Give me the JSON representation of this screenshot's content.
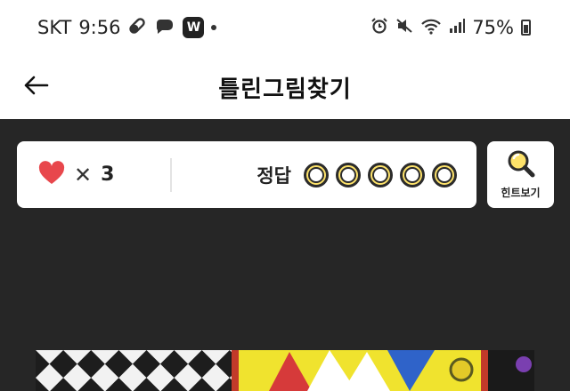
{
  "status_bar": {
    "carrier": "SKT",
    "time": "9:56",
    "battery_percent": "75%",
    "icons": [
      "pill-icon",
      "chat-bubble-icon",
      "w-app-icon",
      "alarm-icon",
      "mute-icon",
      "wifi-icon",
      "signal-icon",
      "battery-icon"
    ],
    "w_badge": "W"
  },
  "app_bar": {
    "back_icon": "arrow-left-icon",
    "title": "틀린그림찾기"
  },
  "score": {
    "lives_x": "✕",
    "lives_count": "3",
    "answers_label": "정답",
    "answers_found": 0,
    "answers_total": 5
  },
  "hint": {
    "label": "힌트보기",
    "icon": "magnifier-icon"
  },
  "colors": {
    "background": "#262626",
    "card": "#ffffff",
    "heart": "#e8474c",
    "slot_yellow": "#fde26a"
  }
}
